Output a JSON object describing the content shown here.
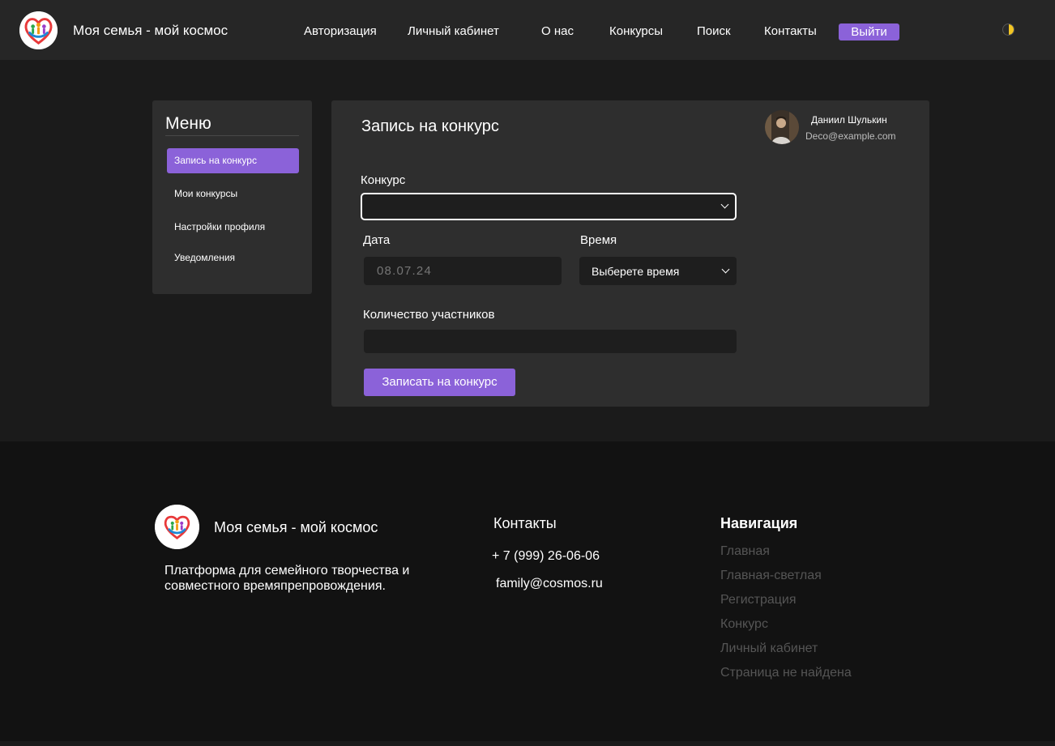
{
  "header": {
    "site_title": "Моя семья - мой космос",
    "nav": [
      {
        "label": "Авторизация"
      },
      {
        "label": "Личный кабинет"
      },
      {
        "label": "О нас"
      },
      {
        "label": "Конкурсы"
      },
      {
        "label": "Поиск"
      },
      {
        "label": "Контакты"
      }
    ],
    "logout_label": "Выйти"
  },
  "sidebar": {
    "title": "Меню",
    "items": [
      {
        "label": "Запись на конкурс",
        "active": true
      },
      {
        "label": "Мои конкурсы",
        "active": false
      },
      {
        "label": "Настройки профиля",
        "active": false
      },
      {
        "label": "Уведомления",
        "active": false
      }
    ]
  },
  "form": {
    "title": "Запись на конкурс",
    "user": {
      "name": "Даниил Шулькин",
      "email": "Deco@example.com"
    },
    "contest_label": "Конкурс",
    "contest_value": "",
    "date_label": "Дата",
    "date_placeholder": "08.07.24",
    "time_label": "Время",
    "time_value": "Выберете время",
    "participants_label": "Количество участников",
    "participants_value": "",
    "submit_label": "Записать на конкурс"
  },
  "footer": {
    "site_title": "Моя семья - мой космос",
    "description": "Платформа для семейного творчества и совместного времяпрепровождения.",
    "contacts_heading": "Контакты",
    "phone": "+ 7 (999) 26-06-06",
    "email": "family@cosmos.ru",
    "nav_heading": "Навигация",
    "nav_links": [
      {
        "label": "Главная"
      },
      {
        "label": "Главная-светлая"
      },
      {
        "label": "Регистрация"
      },
      {
        "label": "Конкурс"
      },
      {
        "label": "Личный кабинет"
      },
      {
        "label": "Страница не найдена"
      }
    ]
  },
  "colors": {
    "accent": "#8b62d9",
    "page_background": "#1b1b1b",
    "header_background": "#262626",
    "card_background": "#2e2e2e",
    "input_background": "#1e1e1e",
    "footer_background": "#121212",
    "muted_link": "#555555",
    "theme_toggle_sun": "#f3c623"
  },
  "icons": {
    "logo": "family-heart-logo-icon",
    "theme_toggle": "half-moon-sun-icon",
    "dropdown": "chevron-down-icon",
    "avatar": "user-photo-avatar"
  }
}
